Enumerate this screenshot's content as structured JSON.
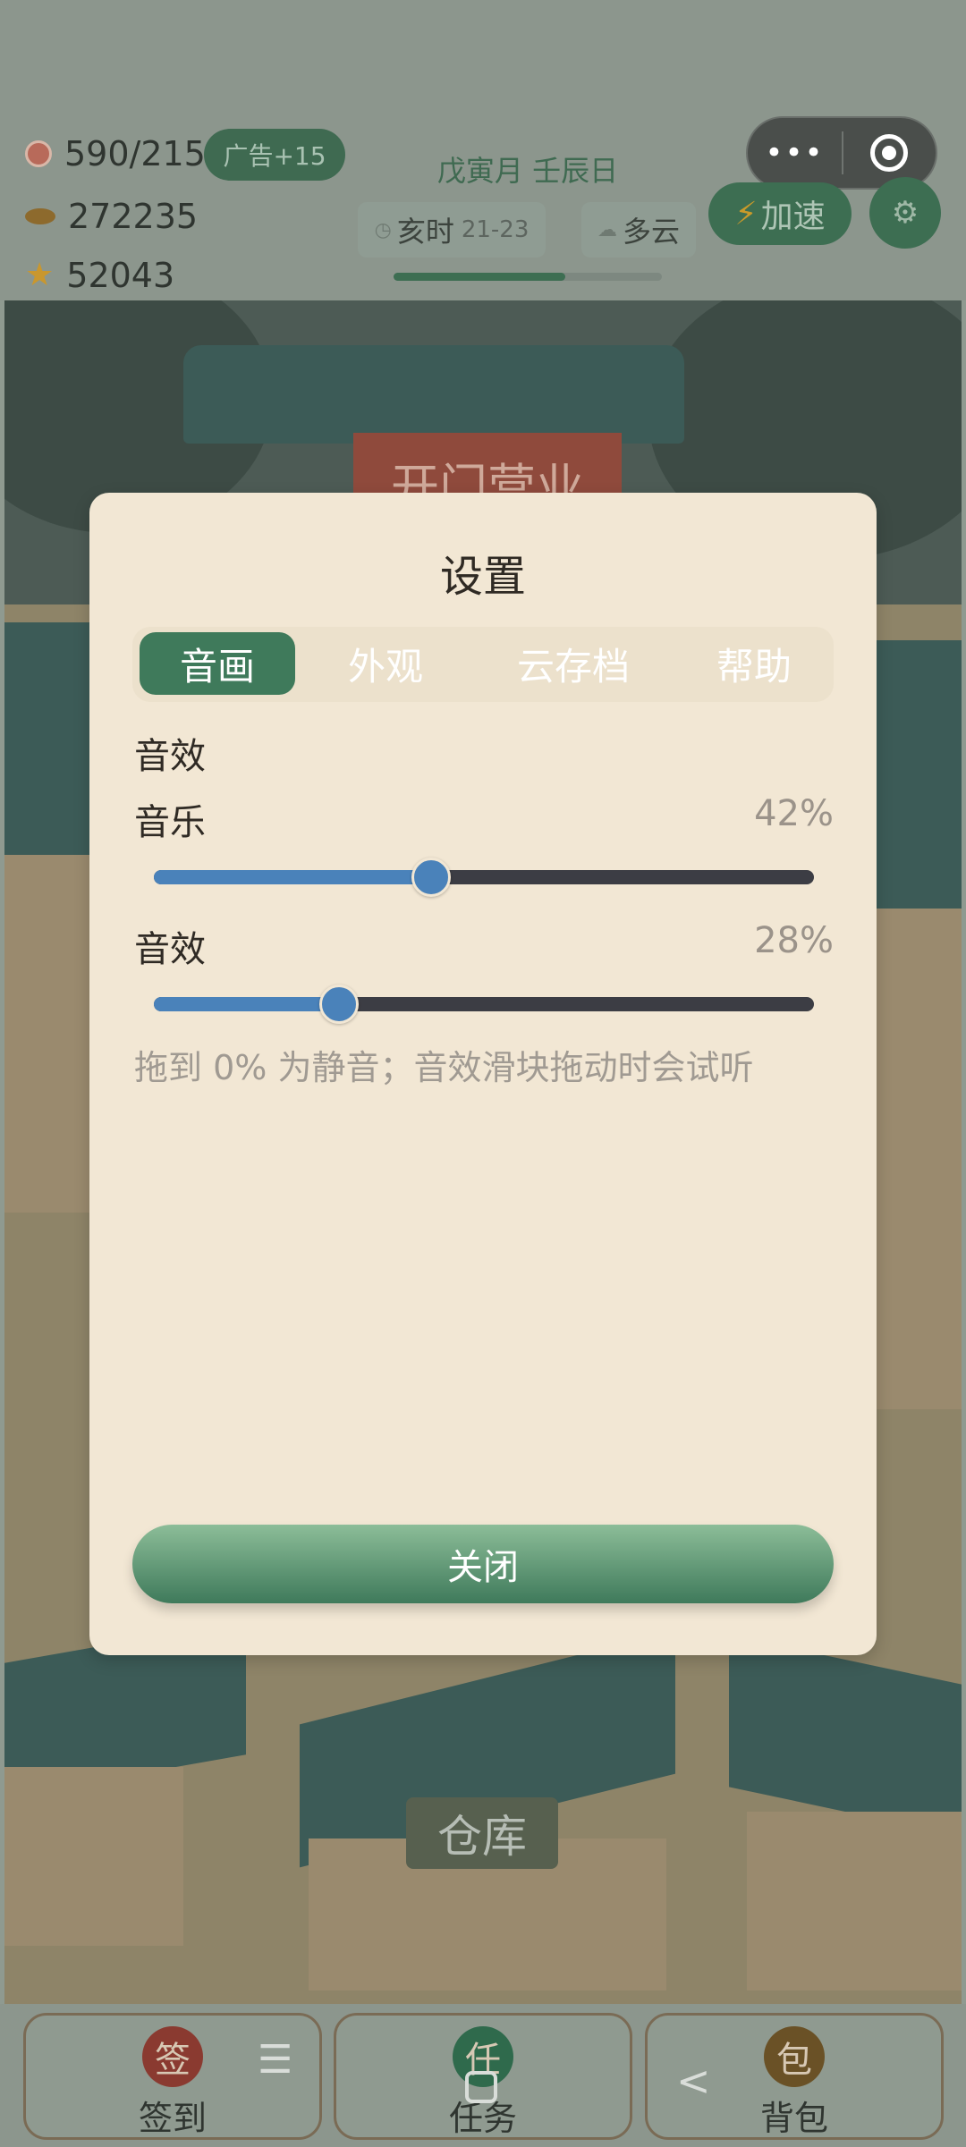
{
  "hud": {
    "energy": "590/215",
    "ad_label": "广告+15",
    "coins": "272235",
    "stars": "52043",
    "date": "戊寅月 壬辰日",
    "time_label": "亥时",
    "time_range": "21-23",
    "weather": "多云",
    "day_progress": 0.64,
    "speed_label": "加速",
    "icons": {
      "energy": "energy-icon",
      "coins": "coin-icon",
      "stars": "star-icon",
      "time": "clock-icon",
      "weather": "cloud-icon",
      "settings": "gear-icon"
    }
  },
  "capsule": {
    "more": "•••"
  },
  "scene": {
    "gate_sign": "开门营业",
    "warehouse": "仓库"
  },
  "settings": {
    "title": "设置",
    "tabs": [
      {
        "label": "音画",
        "active": true
      },
      {
        "label": "外观",
        "active": false
      },
      {
        "label": "云存档",
        "active": false
      },
      {
        "label": "帮助",
        "active": false
      }
    ],
    "section_label": "音效",
    "music": {
      "label": "音乐",
      "value_text": "42%",
      "value": 42
    },
    "sfx": {
      "label": "音效",
      "value_text": "28%",
      "value": 28
    },
    "hint": "拖到 0% 为静音；音效滑块拖动时会试听",
    "close_label": "关闭"
  },
  "bottom_nav": [
    {
      "badge": "签",
      "label": "签到",
      "color": "#8a3a30"
    },
    {
      "badge": "任",
      "label": "任务",
      "color": "#2f6a4c"
    },
    {
      "badge": "包",
      "label": "背包",
      "color": "#6a5126"
    }
  ],
  "system_nav": {
    "menu": "☰",
    "back": "<"
  },
  "colors": {
    "accent_green": "#3f7a5b",
    "slider_blue": "#4a82ba",
    "panel_bg": "#f2e7d4"
  }
}
